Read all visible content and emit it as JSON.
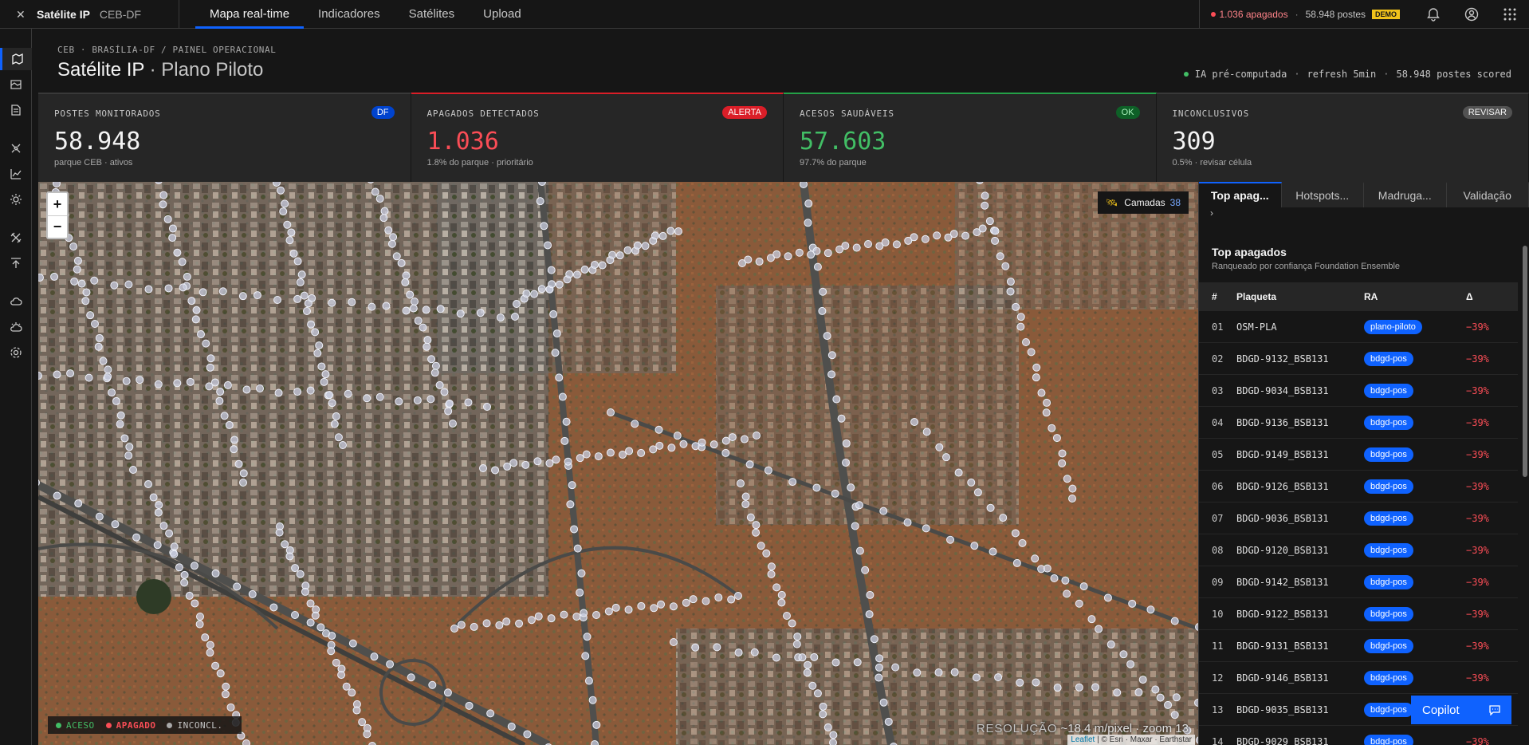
{
  "brand": {
    "name": "Satélite IP",
    "org": "CEB-DF"
  },
  "nav": [
    "Mapa real-time",
    "Indicadores",
    "Satélites",
    "Upload"
  ],
  "status": {
    "apagados": "1.036 apagados",
    "postes": "58.948 postes",
    "demo": "DEMO"
  },
  "header": {
    "breadcrumb": "CEB · BRASÍLIA-DF / PAINEL OPERACIONAL",
    "title": "Satélite IP",
    "title_sub": " · Plano Piloto",
    "meta": [
      "IA pré-computada",
      "refresh 5min",
      "58.948 postes scored"
    ]
  },
  "kpis": [
    {
      "label": "POSTES MONITORADOS",
      "badge": "DF",
      "value": "58.948",
      "note": "parque CEB · ativos",
      "badge_color": "#0043ce"
    },
    {
      "label": "APAGADOS DETECTADOS",
      "badge": "ALERTA",
      "value": "1.036",
      "note": "1.8% do parque · prioritário",
      "badge_color": "#da1e28"
    },
    {
      "label": "ACESOS SAUDÁVEIS",
      "badge": "OK",
      "value": "57.603",
      "note": "97.7% do parque",
      "badge_color": "#0e6027"
    },
    {
      "label": "INCONCLUSIVOS",
      "badge": "REVISAR",
      "value": "309",
      "note": "0.5% · revisar célula",
      "badge_color": "#525252"
    }
  ],
  "map": {
    "zoom_in": "+",
    "zoom_out": "−",
    "layers_label": "Camadas",
    "layers_count": "38",
    "legend": {
      "aceso": "ACESO",
      "apagado": "APAGADO",
      "inconcl": "INCONCL."
    },
    "scale_label": "RESOLUÇÃO",
    "scale_value": "~18.4 m/pixel",
    "zoom_level": "· zoom 13",
    "attribution_leaflet": "Leaflet",
    "attribution_rest": " | © Esri · Maxar · Earthstar"
  },
  "panel": {
    "tabs": [
      "Top apag...",
      "Hotspots...",
      "Madruga...",
      "Validação"
    ],
    "more": "›",
    "title": "Top apagados",
    "subtitle": "Ranqueado por confiança Foundation Ensemble",
    "headers": {
      "n": "#",
      "plaqueta": "Plaqueta",
      "ra": "RA",
      "delta": "Δ"
    },
    "rows": [
      {
        "n": "01",
        "plaqueta": "OSM-PLA",
        "ra": "plano-piloto",
        "delta": "−39%"
      },
      {
        "n": "02",
        "plaqueta": "BDGD-9132_BSB131",
        "ra": "bdgd-pos",
        "delta": "−39%"
      },
      {
        "n": "03",
        "plaqueta": "BDGD-9034_BSB131",
        "ra": "bdgd-pos",
        "delta": "−39%"
      },
      {
        "n": "04",
        "plaqueta": "BDGD-9136_BSB131",
        "ra": "bdgd-pos",
        "delta": "−39%"
      },
      {
        "n": "05",
        "plaqueta": "BDGD-9149_BSB131",
        "ra": "bdgd-pos",
        "delta": "−39%"
      },
      {
        "n": "06",
        "plaqueta": "BDGD-9126_BSB131",
        "ra": "bdgd-pos",
        "delta": "−39%"
      },
      {
        "n": "07",
        "plaqueta": "BDGD-9036_BSB131",
        "ra": "bdgd-pos",
        "delta": "−39%"
      },
      {
        "n": "08",
        "plaqueta": "BDGD-9120_BSB131",
        "ra": "bdgd-pos",
        "delta": "−39%"
      },
      {
        "n": "09",
        "plaqueta": "BDGD-9142_BSB131",
        "ra": "bdgd-pos",
        "delta": "−39%"
      },
      {
        "n": "10",
        "plaqueta": "BDGD-9122_BSB131",
        "ra": "bdgd-pos",
        "delta": "−39%"
      },
      {
        "n": "11",
        "plaqueta": "BDGD-9131_BSB131",
        "ra": "bdgd-pos",
        "delta": "−39%"
      },
      {
        "n": "12",
        "plaqueta": "BDGD-9146_BSB131",
        "ra": "bdgd-pos",
        "delta": "−39%"
      },
      {
        "n": "13",
        "plaqueta": "BDGD-9035_BSB131",
        "ra": "bdgd-pos",
        "delta": "−39%"
      },
      {
        "n": "14",
        "plaqueta": "BDGD-9029_BSB131",
        "ra": "bdgd-pos",
        "delta": "−39%"
      }
    ]
  },
  "copilot": {
    "label": "Copilot"
  },
  "colors": {
    "accent": "#0f62fe",
    "aceso": "#42be65",
    "apagado": "#fa4d56",
    "inconcl": "#a8a8a8"
  }
}
